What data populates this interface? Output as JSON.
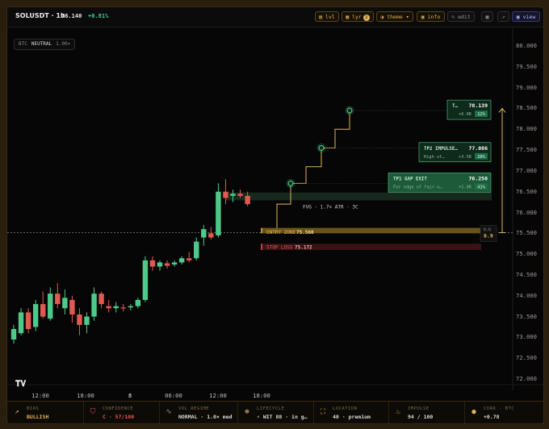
{
  "header": {
    "symbol": "SOLUSDT · 1h",
    "price": "76.140",
    "change": "+0.81%",
    "buttons": {
      "lvl": "lvl",
      "lyr": "lyr",
      "lyr_badge": "2",
      "theme": "theme ▾",
      "info": "info",
      "edit": "edit",
      "view": "view"
    }
  },
  "status_pill": {
    "ref": "BTC",
    "state": "NEUTRAL",
    "mult": "1.00×"
  },
  "y_axis": [
    "80.000",
    "79.500",
    "79.000",
    "78.500",
    "78.000",
    "77.500",
    "77.000",
    "76.500",
    "76.000",
    "75.500",
    "75.000",
    "74.500",
    "74.000",
    "73.500",
    "73.000",
    "72.500",
    "72.000"
  ],
  "x_axis": [
    "12:00",
    "18:00",
    "8",
    "06:00",
    "12:00",
    "18:00"
  ],
  "levels": {
    "fvg": "FVG · 1.7× ATR · 3C",
    "entry_label": "ENTRY ZONE",
    "entry_value": "75.560",
    "stop_label": "STOP LOSS",
    "stop_value": "75.172",
    "rr_label": "R:R",
    "rr_value": "0.9"
  },
  "targets": [
    {
      "name": "TP1 GAP EXIT",
      "value": "76.250",
      "sub": "For edge of fair-v…",
      "gain": "+1.0R",
      "pct": "41%"
    },
    {
      "name": "TP2 IMPULSE…",
      "value": "77.086",
      "sub": "High of…",
      "gain": "+3.5R",
      "pct": "28%"
    },
    {
      "name": "T…",
      "value": "78.139",
      "sub": "",
      "gain": "+6.0R",
      "pct": "12%"
    }
  ],
  "bottom": [
    {
      "label": "BIAS",
      "value": "BULLISH",
      "icon": "trend-up-icon"
    },
    {
      "label": "CONFIDENCE",
      "value": "C · 57/100",
      "icon": "shield-icon"
    },
    {
      "label": "VOL REGIME",
      "value": "NORMAL · 1.0× med",
      "icon": "wave-icon"
    },
    {
      "label": "LIFECYCLE",
      "value": "⚡ WIT 88 · in g…",
      "icon": "cycle-icon"
    },
    {
      "label": "LOCATION",
      "value": "40 · premium",
      "icon": "location-icon"
    },
    {
      "label": "IMPULSE",
      "value": "94 / 100",
      "icon": "flame-icon"
    },
    {
      "label": "CORR · BTC",
      "value": "+0.78",
      "icon": "coin-icon"
    }
  ],
  "colors": {
    "bull": "#4fc98a",
    "bear": "#e05a52",
    "accent": "#e0b458",
    "tp": "#1f6e47"
  },
  "chart_data": {
    "type": "candlestick",
    "ylim": [
      71.8,
      80.2
    ],
    "candles": [
      {
        "o": 72.95,
        "h": 73.3,
        "l": 72.85,
        "c": 73.2
      },
      {
        "o": 73.1,
        "h": 73.7,
        "l": 73.05,
        "c": 73.6
      },
      {
        "o": 73.6,
        "h": 73.7,
        "l": 73.1,
        "c": 73.2
      },
      {
        "o": 73.25,
        "h": 73.9,
        "l": 73.15,
        "c": 73.8
      },
      {
        "o": 73.8,
        "h": 74.1,
        "l": 73.45,
        "c": 73.5
      },
      {
        "o": 73.45,
        "h": 74.2,
        "l": 73.4,
        "c": 74.05
      },
      {
        "o": 74.05,
        "h": 74.3,
        "l": 73.7,
        "c": 73.8
      },
      {
        "o": 73.7,
        "h": 74.15,
        "l": 73.55,
        "c": 73.95
      },
      {
        "o": 73.9,
        "h": 74.0,
        "l": 73.35,
        "c": 73.55
      },
      {
        "o": 73.55,
        "h": 73.7,
        "l": 73.05,
        "c": 73.3
      },
      {
        "o": 73.3,
        "h": 73.6,
        "l": 73.1,
        "c": 73.5
      },
      {
        "o": 73.5,
        "h": 74.2,
        "l": 73.4,
        "c": 74.05
      },
      {
        "o": 74.05,
        "h": 74.1,
        "l": 73.7,
        "c": 73.8
      },
      {
        "o": 73.75,
        "h": 73.9,
        "l": 73.6,
        "c": 73.7
      },
      {
        "o": 73.7,
        "h": 73.85,
        "l": 73.6,
        "c": 73.75
      },
      {
        "o": 73.72,
        "h": 73.8,
        "l": 73.62,
        "c": 73.7
      },
      {
        "o": 73.72,
        "h": 73.8,
        "l": 73.65,
        "c": 73.75
      },
      {
        "o": 73.75,
        "h": 73.95,
        "l": 73.7,
        "c": 73.9
      },
      {
        "o": 73.9,
        "h": 74.95,
        "l": 73.85,
        "c": 74.85
      },
      {
        "o": 74.85,
        "h": 74.95,
        "l": 74.6,
        "c": 74.7
      },
      {
        "o": 74.7,
        "h": 74.85,
        "l": 74.6,
        "c": 74.8
      },
      {
        "o": 74.78,
        "h": 74.85,
        "l": 74.65,
        "c": 74.72
      },
      {
        "o": 74.75,
        "h": 74.85,
        "l": 74.7,
        "c": 74.8
      },
      {
        "o": 74.8,
        "h": 74.95,
        "l": 74.75,
        "c": 74.9
      },
      {
        "o": 74.9,
        "h": 75.05,
        "l": 74.8,
        "c": 74.85
      },
      {
        "o": 74.9,
        "h": 75.4,
        "l": 74.85,
        "c": 75.3
      },
      {
        "o": 75.4,
        "h": 75.7,
        "l": 75.2,
        "c": 75.6
      },
      {
        "o": 75.5,
        "h": 75.65,
        "l": 75.35,
        "c": 75.4
      },
      {
        "o": 75.45,
        "h": 76.7,
        "l": 75.4,
        "c": 76.5
      },
      {
        "o": 76.5,
        "h": 76.8,
        "l": 76.2,
        "c": 76.35
      },
      {
        "o": 76.4,
        "h": 76.55,
        "l": 76.25,
        "c": 76.45
      },
      {
        "o": 76.45,
        "h": 76.55,
        "l": 76.35,
        "c": 76.4
      },
      {
        "o": 76.4,
        "h": 76.5,
        "l": 76.15,
        "c": 76.2
      }
    ]
  }
}
